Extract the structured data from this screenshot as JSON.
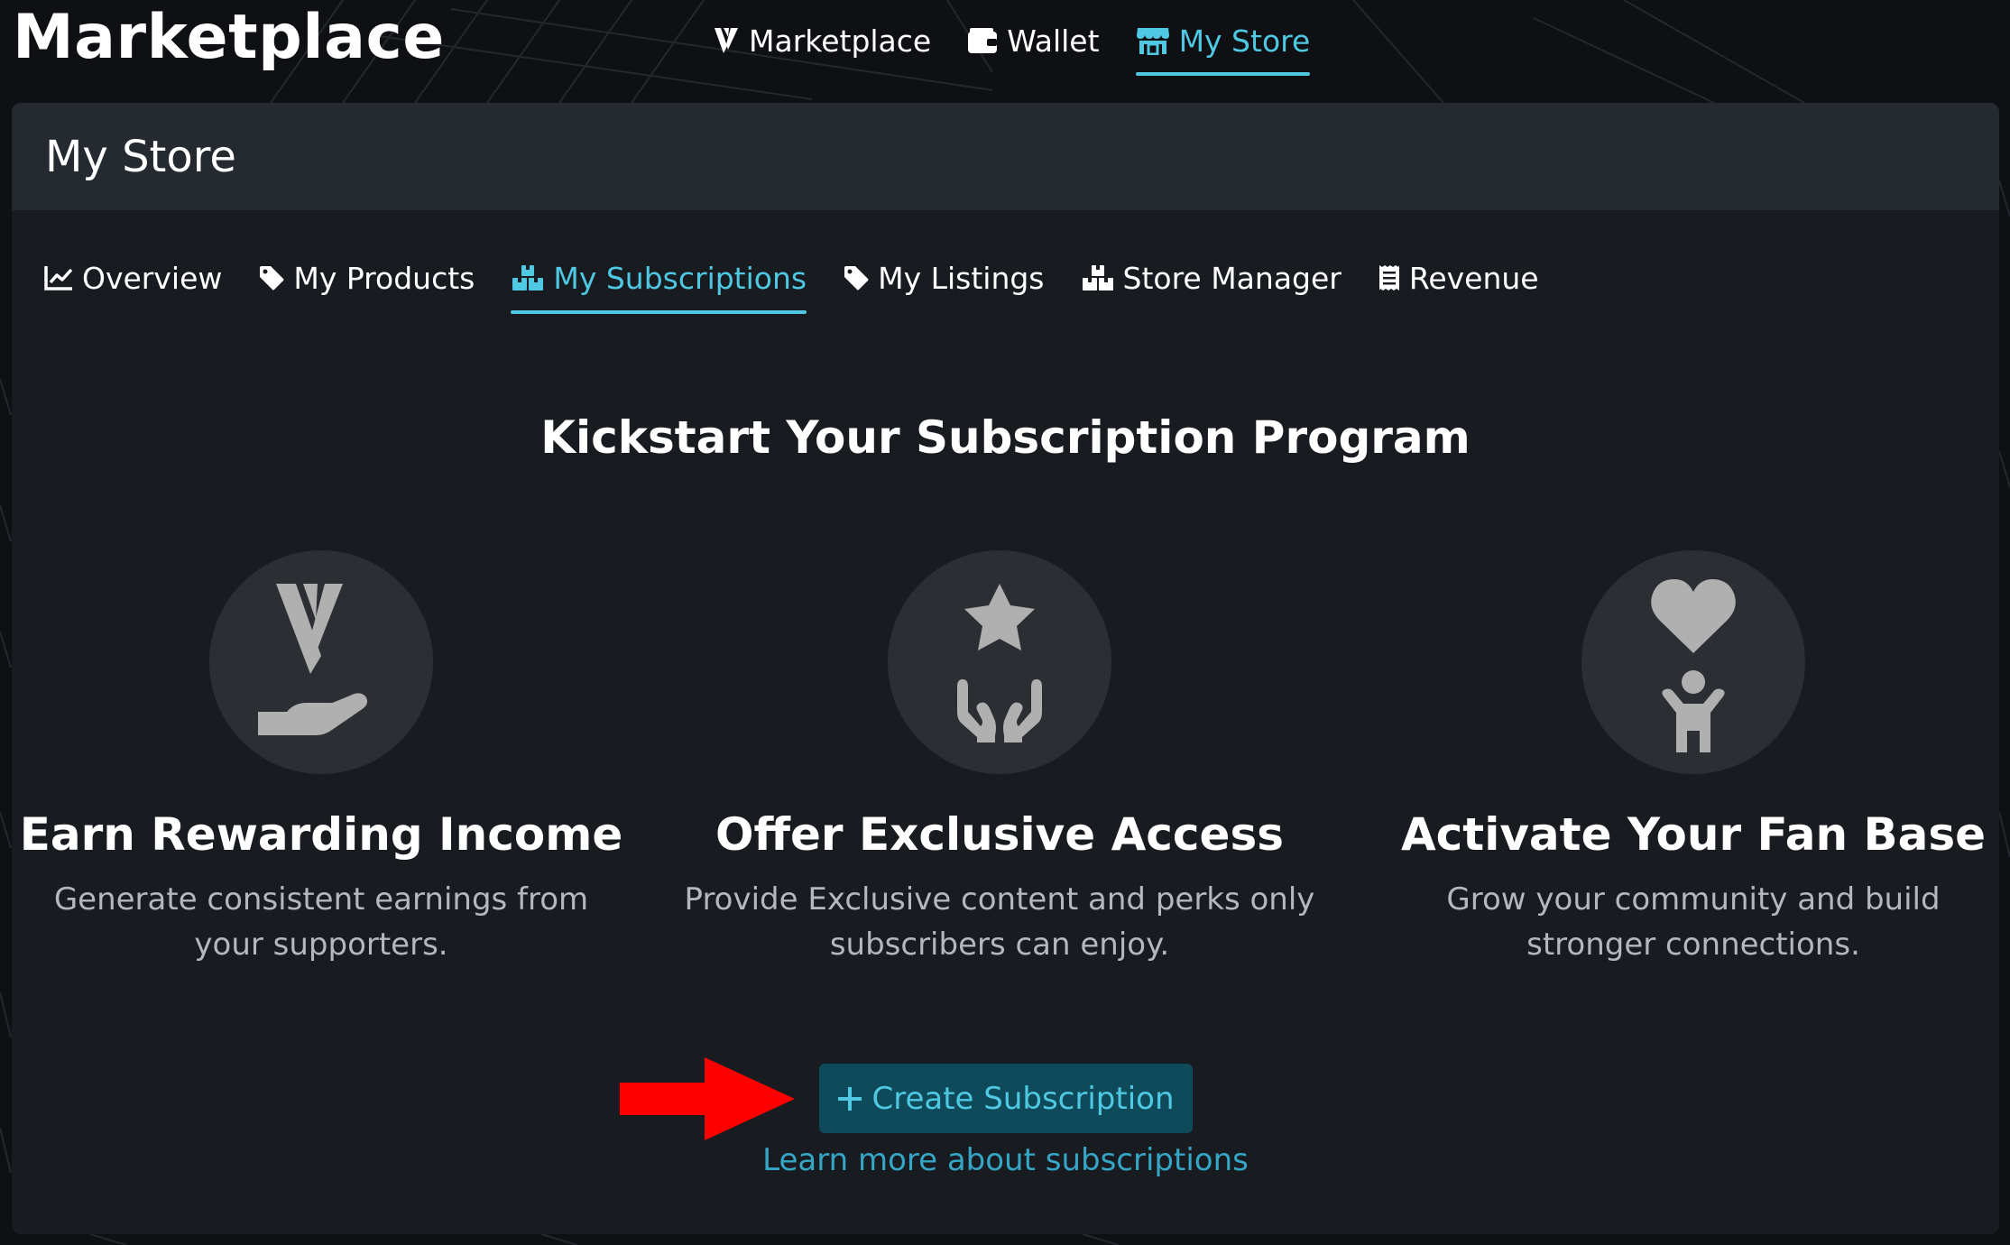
{
  "header": {
    "app_title": "Marketplace",
    "nav": [
      {
        "label": "Marketplace",
        "icon": "v-logo-icon",
        "active": false
      },
      {
        "label": "Wallet",
        "icon": "wallet-icon",
        "active": false
      },
      {
        "label": "My Store",
        "icon": "store-icon",
        "active": true
      }
    ]
  },
  "panel": {
    "title": "My Store",
    "tabs": [
      {
        "label": "Overview",
        "icon": "chart-line-icon",
        "active": false
      },
      {
        "label": "My Products",
        "icon": "tag-icon",
        "active": false
      },
      {
        "label": "My Subscriptions",
        "icon": "boxes-icon",
        "active": true
      },
      {
        "label": "My Listings",
        "icon": "tag-icon",
        "active": false
      },
      {
        "label": "Store Manager",
        "icon": "boxes-icon",
        "active": false
      },
      {
        "label": "Revenue",
        "icon": "receipt-icon",
        "active": false
      }
    ],
    "headline": "Kickstart Your Subscription Program",
    "features": [
      {
        "icon": "hand-coin-icon",
        "title": "Earn Rewarding Income",
        "desc_line1": "Generate consistent earnings from",
        "desc_line2": "your supporters."
      },
      {
        "icon": "star-hands-icon",
        "title": "Offer Exclusive Access",
        "desc_line1": "Provide Exclusive content and perks only",
        "desc_line2": "subscribers can enjoy."
      },
      {
        "icon": "heart-person-icon",
        "title": "Activate Your Fan Base",
        "desc_line1": "Grow your community and build",
        "desc_line2": "stronger connections."
      }
    ],
    "cta": {
      "icon": "plus-icon",
      "label": "Create Subscription"
    },
    "learn_more": "Learn more about subscriptions"
  },
  "colors": {
    "accent": "#4fc8e2",
    "button_bg": "#0f4a5b",
    "panel_bg": "#181b20",
    "header_bg": "#252930",
    "annotation_arrow": "#ff0000"
  }
}
